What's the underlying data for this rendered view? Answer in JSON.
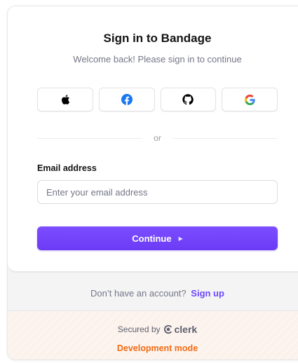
{
  "signin": {
    "title": "Sign in to Bandage",
    "subtitle": "Welcome back! Please sign in to continue"
  },
  "social": {
    "providers": [
      {
        "name": "apple",
        "icon": "apple-icon"
      },
      {
        "name": "facebook",
        "icon": "facebook-icon",
        "color": "#1877f2"
      },
      {
        "name": "github",
        "icon": "github-icon"
      },
      {
        "name": "google",
        "icon": "google-icon"
      }
    ]
  },
  "divider": {
    "text": "or"
  },
  "form": {
    "email_label": "Email address",
    "email_placeholder": "Enter your email address",
    "email_value": "",
    "continue_label": "Continue",
    "continue_arrow": "▶"
  },
  "signup": {
    "prompt": "Don’t have an account?",
    "link": "Sign up"
  },
  "footer": {
    "secured_by": "Secured by",
    "brand": "clerk",
    "dev_mode": "Development mode"
  },
  "colors": {
    "accent": "#6c47ff",
    "dev_mode": "#f36b16"
  }
}
